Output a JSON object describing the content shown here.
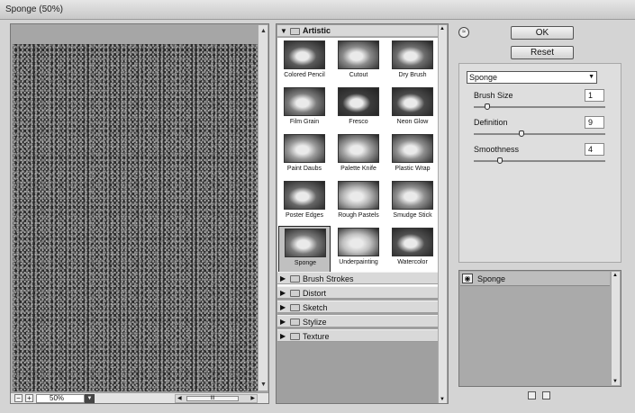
{
  "window": {
    "title": "Sponge (50%)"
  },
  "preview": {
    "zoom": "50%",
    "zoom_out": "−",
    "zoom_in": "+",
    "scroll_grip": "III"
  },
  "gallery": {
    "open_category": "Artistic",
    "filters": [
      {
        "label": "Colored Pencil",
        "tone": "#5a5a5a"
      },
      {
        "label": "Cutout",
        "tone": "#8a8a8a"
      },
      {
        "label": "Dry Brush",
        "tone": "#6e6e6e"
      },
      {
        "label": "Film Grain",
        "tone": "#7c7c7c"
      },
      {
        "label": "Fresco",
        "tone": "#3c3c3c"
      },
      {
        "label": "Neon Glow",
        "tone": "#4a4a4a"
      },
      {
        "label": "Paint Daubs",
        "tone": "#9a9a9a"
      },
      {
        "label": "Palette Knife",
        "tone": "#a0a0a0"
      },
      {
        "label": "Plastic Wrap",
        "tone": "#8e8e8e"
      },
      {
        "label": "Poster Edges",
        "tone": "#666666"
      },
      {
        "label": "Rough Pastels",
        "tone": "#b4b4b4"
      },
      {
        "label": "Smudge Stick",
        "tone": "#909090"
      },
      {
        "label": "Sponge",
        "tone": "#7a7a7a"
      },
      {
        "label": "Underpainting",
        "tone": "#c0c0c0"
      },
      {
        "label": "Watercolor",
        "tone": "#505050"
      }
    ],
    "selected": "Sponge",
    "categories": [
      "Brush Strokes",
      "Distort",
      "Sketch",
      "Stylize",
      "Texture"
    ]
  },
  "buttons": {
    "ok": "OK",
    "reset": "Reset"
  },
  "filter_select": "Sponge",
  "params": [
    {
      "label": "Brush Size",
      "value": "1",
      "level": 0.1
    },
    {
      "label": "Definition",
      "value": "9",
      "level": 0.36
    },
    {
      "label": "Smoothness",
      "value": "4",
      "level": 0.2
    }
  ],
  "layers": [
    {
      "label": "Sponge"
    }
  ]
}
